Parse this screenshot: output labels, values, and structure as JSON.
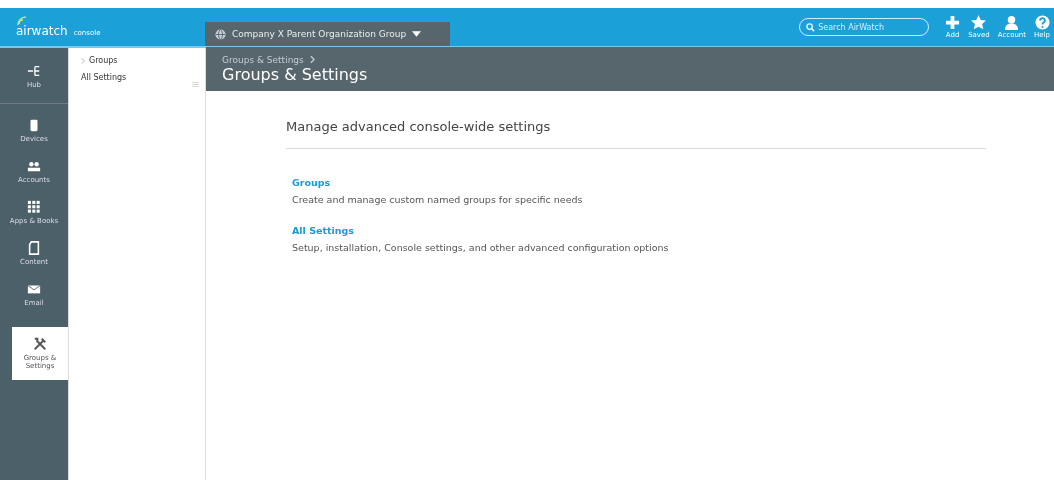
{
  "brand": {
    "name": "airwatch",
    "sub": "console"
  },
  "org_selector": {
    "label": "Company X Parent Organization Group"
  },
  "search": {
    "placeholder": "Search AirWatch"
  },
  "top_actions": [
    {
      "kind": "add",
      "label": "Add"
    },
    {
      "kind": "saved",
      "label": "Saved"
    },
    {
      "kind": "account",
      "label": "Account"
    },
    {
      "kind": "help",
      "label": "Help"
    }
  ],
  "sidebar": {
    "items": [
      {
        "kind": "hub",
        "label": "Hub",
        "selected": false
      },
      {
        "kind": "devices",
        "label": "Devices",
        "selected": false
      },
      {
        "kind": "accounts",
        "label": "Accounts",
        "selected": false
      },
      {
        "kind": "apps",
        "label": "Apps & Books",
        "selected": false
      },
      {
        "kind": "content",
        "label": "Content",
        "selected": false
      },
      {
        "kind": "email",
        "label": "Email",
        "selected": false
      },
      {
        "kind": "settings",
        "label": "Groups & Settings",
        "selected": true
      }
    ]
  },
  "subnav": {
    "items": [
      {
        "label": "Groups",
        "expandable": true
      },
      {
        "label": "All Settings",
        "expandable": false
      }
    ]
  },
  "breadcrumb": "Groups & Settings",
  "page_title": "Groups & Settings",
  "intro": "Manage advanced console-wide settings",
  "sections": [
    {
      "title": "Groups",
      "description": "Create and manage custom named groups for specific needs"
    },
    {
      "title": "All Settings",
      "description": "Setup, installation, Console settings, and other advanced configuration options"
    }
  ]
}
